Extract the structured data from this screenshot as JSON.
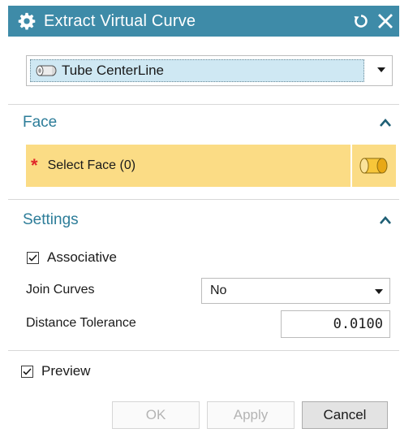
{
  "window": {
    "title": "Extract Virtual Curve"
  },
  "type_selector": {
    "value": "Tube CenterLine",
    "icon": "tube-icon"
  },
  "face_section": {
    "header": "Face",
    "select_label": "Select Face (0)",
    "required_marker": "*",
    "icon": "cylinder-face-icon"
  },
  "settings_section": {
    "header": "Settings",
    "associative": {
      "label": "Associative",
      "checked": true
    },
    "join_curves": {
      "label": "Join Curves",
      "value": "No"
    },
    "distance_tolerance": {
      "label": "Distance Tolerance",
      "value": "0.0100"
    }
  },
  "preview": {
    "label": "Preview",
    "checked": true
  },
  "buttons": {
    "ok": "OK",
    "apply": "Apply",
    "cancel": "Cancel"
  },
  "colors": {
    "title_bar": "#3e8ba8",
    "section_header": "#2d7d99",
    "selection_highlight": "#fbdc85",
    "required_star": "#e0262a"
  }
}
